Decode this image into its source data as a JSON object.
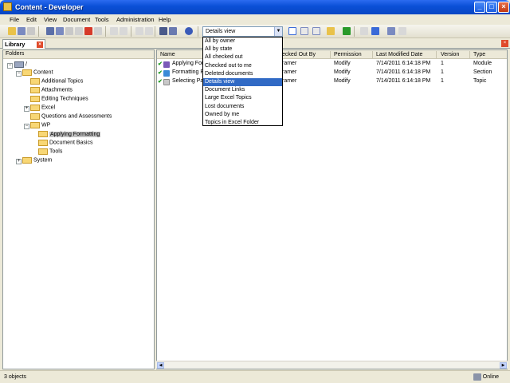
{
  "window": {
    "title": "Content - Developer",
    "min": "_",
    "max": "□",
    "close": "×"
  },
  "menu": [
    "File",
    "Edit",
    "View",
    "Document",
    "Tools",
    "Administration",
    "Help"
  ],
  "toolbar": {
    "view_select_value": "Details view"
  },
  "views": [
    "All by owner",
    "All by state",
    "All checked out",
    "Checked out to me",
    "Deleted documents",
    "Details view",
    "Document Links",
    "Large Excel Topics",
    "Lost documents",
    "Owned by me",
    "Topics in Excel Folder"
  ],
  "selected_view_index": 5,
  "tab": {
    "label": "Library"
  },
  "folders": {
    "header": "Folders",
    "tree": [
      {
        "label": "/",
        "level": 0
      },
      {
        "label": "Content",
        "level": 1
      },
      {
        "label": "Additional Topics",
        "level": 2
      },
      {
        "label": "Attachments",
        "level": 2
      },
      {
        "label": "Editing Techniques",
        "level": 2
      },
      {
        "label": "Excel",
        "level": 2
      },
      {
        "label": "Questions and Assessments",
        "level": 2
      },
      {
        "label": "WP",
        "level": 2
      },
      {
        "label": "Applying Formatting",
        "level": 3
      },
      {
        "label": "Document Basics",
        "level": 3
      },
      {
        "label": "Tools",
        "level": 3
      },
      {
        "label": "System",
        "level": 1
      }
    ]
  },
  "list": {
    "columns": [
      "Name",
      "Checked Out By",
      "Permission",
      "Last Modified Date",
      "Version",
      "Type"
    ],
    "rows": [
      {
        "name": "Applying Form",
        "checked_out_by": "ramer",
        "permission": "Modify",
        "modified": "7/14/2011 6:14:18 PM",
        "version": "1",
        "type": "Module"
      },
      {
        "name": "Formatting Pa",
        "checked_out_by": "ramer",
        "permission": "Modify",
        "modified": "7/14/2011 6:14:18 PM",
        "version": "1",
        "type": "Section"
      },
      {
        "name": "Selecting Par",
        "checked_out_by": "ramer",
        "permission": "Modify",
        "modified": "7/14/2011 6:14:18 PM",
        "version": "1",
        "type": "Topic"
      }
    ]
  },
  "status": {
    "count": "3 objects",
    "connection": "Online"
  },
  "colors": {
    "titlebar": "#0a4fd6",
    "selection": "#316ac5",
    "folder": "#f8d775"
  }
}
